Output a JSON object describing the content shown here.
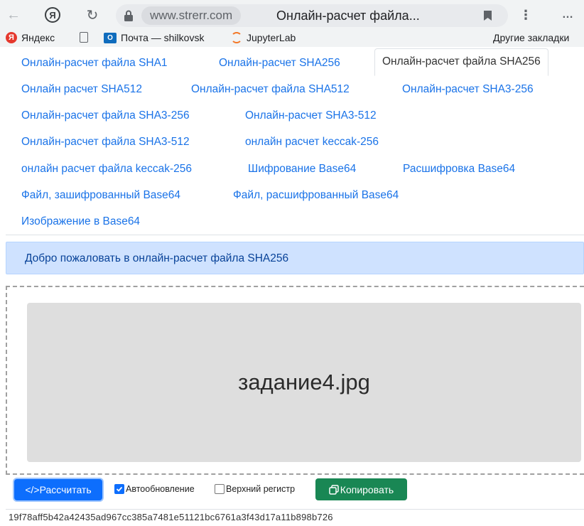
{
  "browser": {
    "domain": "www.strerr.com",
    "tab_title": "Онлайн-расчет файла...",
    "yandex_letter": "Я",
    "menu_glyph": "⋮",
    "more_glyph": "…",
    "bookmarks": [
      {
        "label": "Яндекс",
        "icon": "yandex-icon",
        "badge": "Я"
      },
      {
        "label": "",
        "icon": "page-icon"
      },
      {
        "label": "Почта — shilkovsk",
        "icon": "outlook-icon",
        "badge": "O"
      },
      {
        "label": "JupyterLab",
        "icon": "jupyter-icon"
      }
    ],
    "other_bookmarks": "Другие закладки"
  },
  "tabs": [
    {
      "label": "Онлайн-расчет файла SHA1"
    },
    {
      "label": "Онлайн-расчет SHA256"
    },
    {
      "label": "Онлайн-расчет файла SHA256",
      "active": true
    },
    {
      "label": "Онлайн расчет SHA512"
    },
    {
      "label": "Онлайн-расчет файла SHA512"
    },
    {
      "label": "Онлайн-расчет SHA3-256"
    },
    {
      "label": "Онлайн-расчет файла SHA3-256"
    },
    {
      "label": "Онлайн-расчет SHA3-512"
    },
    {
      "label": "Онлайн-расчет файла SHA3-512"
    },
    {
      "label": "онлайн расчет keccak-256"
    },
    {
      "label": "онлайн расчет файла keccak-256"
    },
    {
      "label": "Шифрование Base64"
    },
    {
      "label": "Расшифровка Base64"
    },
    {
      "label": "Файл, зашифрованный Base64"
    },
    {
      "label": "Файл, расшифрованный Base64"
    },
    {
      "label": "Изображение в Base64"
    }
  ],
  "alert": {
    "text": "Добро пожаловать в онлайн-расчет файла SHA256"
  },
  "dropzone": {
    "file_name": "задание4.jpg"
  },
  "controls": {
    "calculate_label": "</>Рассчитать",
    "auto_update_label": "Автообновление",
    "auto_update_checked": true,
    "uppercase_label": "Верхний регистр",
    "uppercase_checked": false,
    "copy_label": "Копировать"
  },
  "result": {
    "hash": "19f78aff5b42a42435ad967cc385a7481e51121bc6761a3f43d17a11b898b726"
  },
  "colors": {
    "link": "#1a73e8",
    "primary": "#0d6efd",
    "success": "#198754",
    "alert_bg": "#cfe2ff"
  }
}
